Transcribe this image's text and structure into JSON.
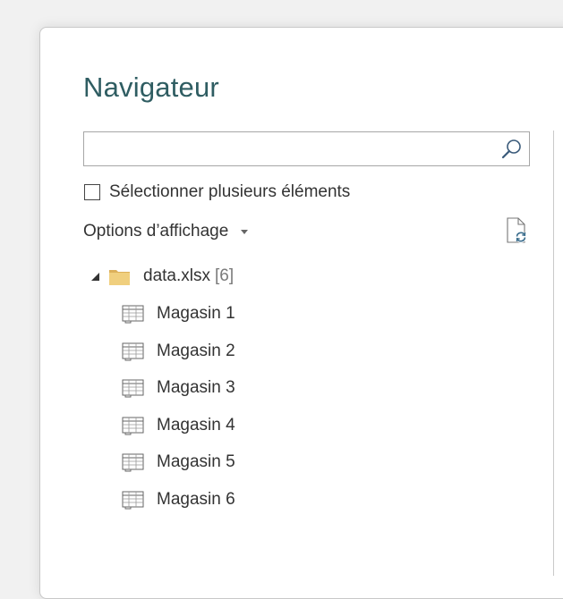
{
  "dialog": {
    "title": "Navigateur"
  },
  "search": {
    "value": "",
    "placeholder": "",
    "icon": "search-icon"
  },
  "multi_select": {
    "label": "Sélectionner plusieurs éléments",
    "checked": false
  },
  "display_options": {
    "label": "Options d’affichage"
  },
  "refresh": {
    "icon": "refresh-icon"
  },
  "tree": {
    "root": {
      "label": "data.xlsx",
      "count": "[6]",
      "expanded": true
    },
    "items": [
      {
        "label": "Magasin 1"
      },
      {
        "label": "Magasin 2"
      },
      {
        "label": "Magasin 3"
      },
      {
        "label": "Magasin 4"
      },
      {
        "label": "Magasin 5"
      },
      {
        "label": "Magasin 6"
      }
    ]
  },
  "colors": {
    "title": "#2f5d62",
    "folder": "#e8c16a",
    "text": "#333333"
  }
}
